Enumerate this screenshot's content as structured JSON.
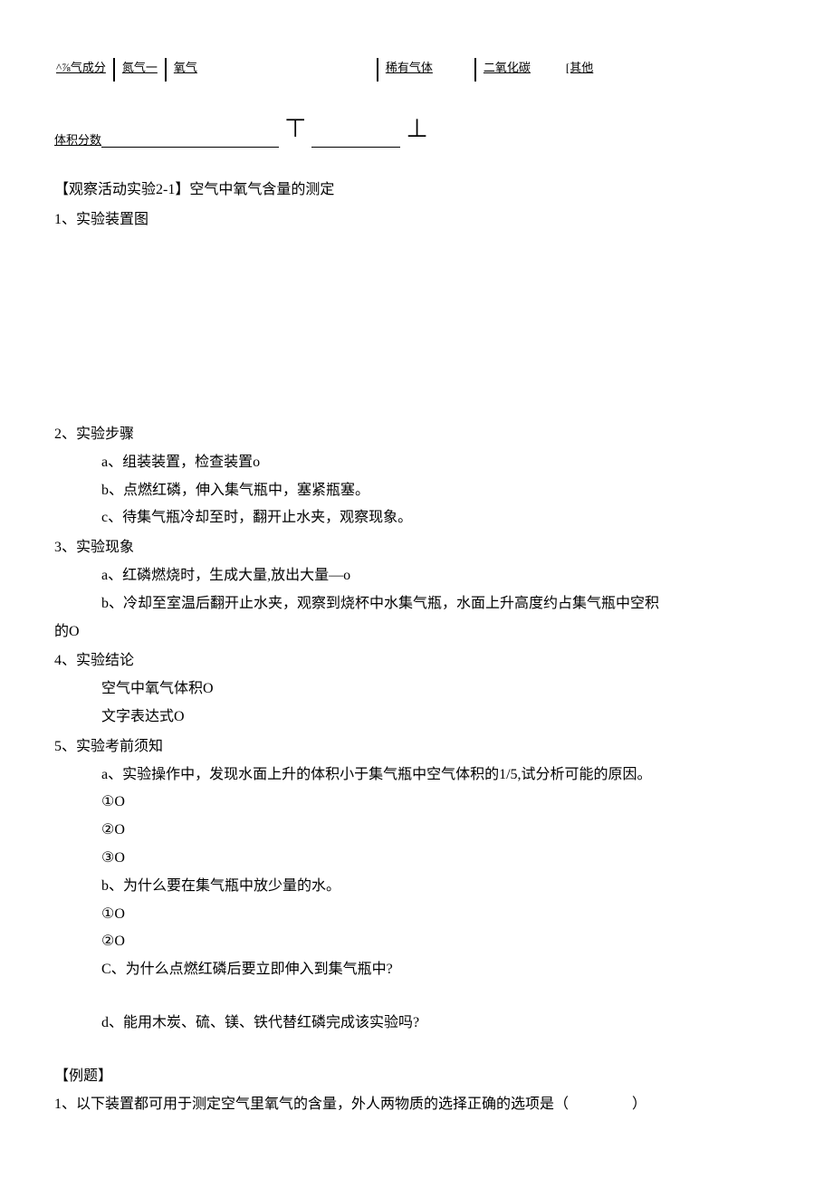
{
  "table": {
    "row1": {
      "col1": "^⅞气成分",
      "col2": "氮气一",
      "col3": "氧气",
      "col4": "稀有气体",
      "col5": "二氧化碳",
      "col6": "[其他"
    },
    "row2": {
      "col1": "体积分数"
    }
  },
  "experiment_title": "【观察活动实验2-1】空气中氧气含量的测定",
  "sec1": {
    "title": "1、实验装置图"
  },
  "sec2": {
    "title": "2、实验步骤",
    "a": "a、组装装置，检查装置o",
    "b": "b、点燃红磷，伸入集气瓶中，塞紧瓶塞。",
    "c": "c、待集气瓶冷却至时，翻开止水夹，观察现象。"
  },
  "sec3": {
    "title": "3、实验现象",
    "a": "a、红磷燃烧时，生成大量,放出大量—o",
    "b": "b、冷却至室温后翻开止水夹，观察到烧杯中水集气瓶，水面上升高度约占集气瓶中空积",
    "b_tail": "的O"
  },
  "sec4": {
    "title": "4、实验结论",
    "line1": "空气中氧气体积O",
    "line2": "文字表达式O"
  },
  "sec5": {
    "title": "5、实验考前须知",
    "a": "a、实验操作中，发现水面上升的体积小于集气瓶中空气体积的1/5,试分析可能的原因。",
    "a1": "①O",
    "a2": "②O",
    "a3": "③O",
    "b": "b、为什么要在集气瓶中放少量的水。",
    "b1": "①O",
    "b2": "②O",
    "c": "C、为什么点燃红磷后要立即伸入到集气瓶中?",
    "d": "d、能用木炭、硫、镁、铁代替红磷完成该实验吗?"
  },
  "examples": {
    "title": "【例题】",
    "q1_pre": "1、以下装置都可用于测定空气里氧气的含量，外人两物质的选择正确的选项是（",
    "q1_post": "）"
  }
}
